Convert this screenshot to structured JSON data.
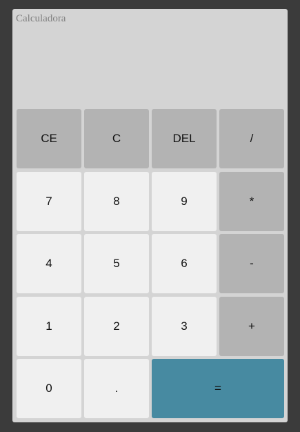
{
  "app": {
    "title": "Calculadora"
  },
  "display": {
    "value": ""
  },
  "keys": {
    "ce": "CE",
    "c": "C",
    "del": "DEL",
    "divide": "/",
    "seven": "7",
    "eight": "8",
    "nine": "9",
    "multiply": "*",
    "four": "4",
    "five": "5",
    "six": "6",
    "subtract": "-",
    "one": "1",
    "two": "2",
    "three": "3",
    "add": "+",
    "zero": "0",
    "decimal": ".",
    "equals": "="
  },
  "colors": {
    "page_background": "#3b3b3b",
    "panel": "#d4d4d4",
    "number_key": "#f0f0f0",
    "function_key": "#b3b3b3",
    "equals_key": "#478aa1"
  }
}
